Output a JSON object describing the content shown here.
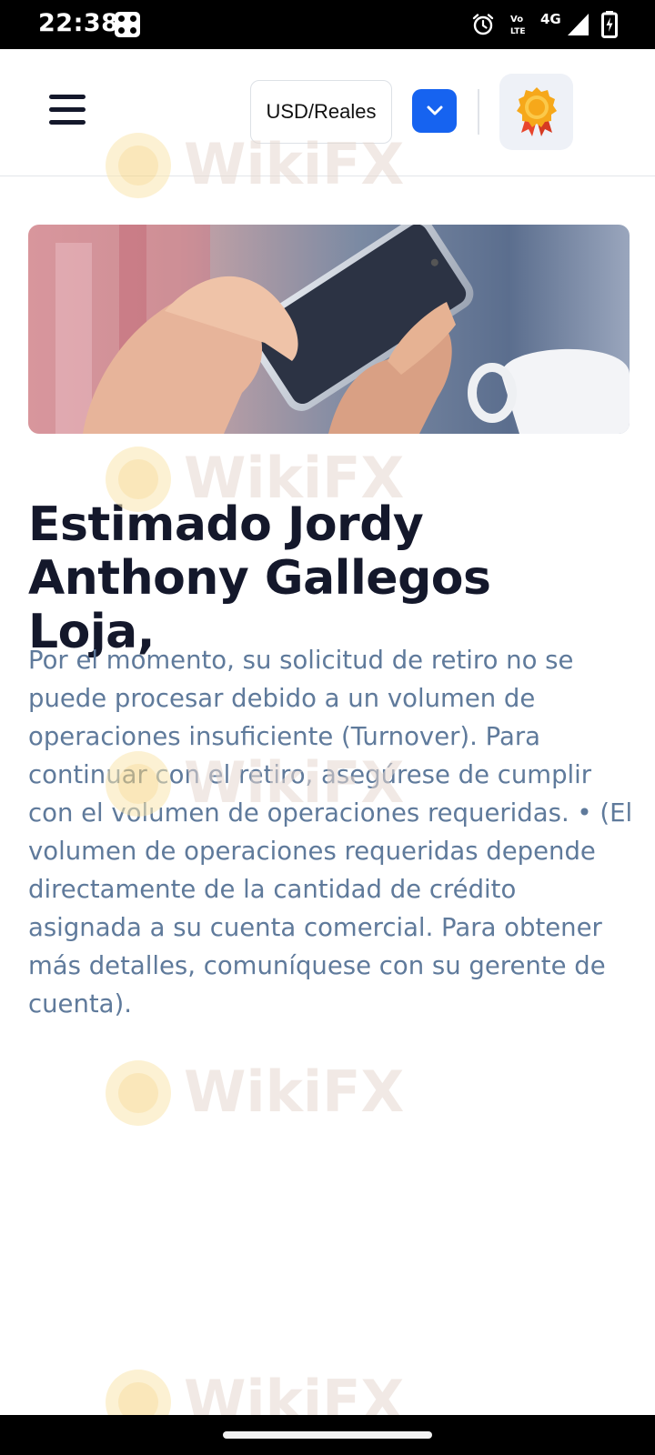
{
  "status_bar": {
    "time": "22:38",
    "network": "4G",
    "icons": [
      "dice-icon",
      "alarm-icon",
      "volte-icon",
      "signal-icon",
      "battery-charging-icon"
    ]
  },
  "header": {
    "menu_icon": "hamburger-menu-icon",
    "currency_label": "USD/Reales",
    "dropdown_icon": "chevron-down-icon",
    "award_icon": "award-medal-icon",
    "accent_color": "#1663f0"
  },
  "banner": {
    "image": "hand-holding-smartphone-photo"
  },
  "content": {
    "greeting": "Estimado Jordy Anthony Gallegos Loja,",
    "message": "Por el momento, su solicitud de retiro no se puede procesar debido a un volumen de operaciones insuficiente (Turnover). Para continuar con el retiro, asegúrese de cumplir con el volumen de operaciones requeridas. • (El volumen de operaciones requeridas depende directamente de la cantidad de crédito asignada a su cuenta comercial. Para obtener más detalles, comuníquese con su gerente de cuenta).",
    "greeting_color": "#14182b",
    "message_color": "#5f7a9b"
  },
  "watermark": {
    "text": "WikiFX"
  }
}
